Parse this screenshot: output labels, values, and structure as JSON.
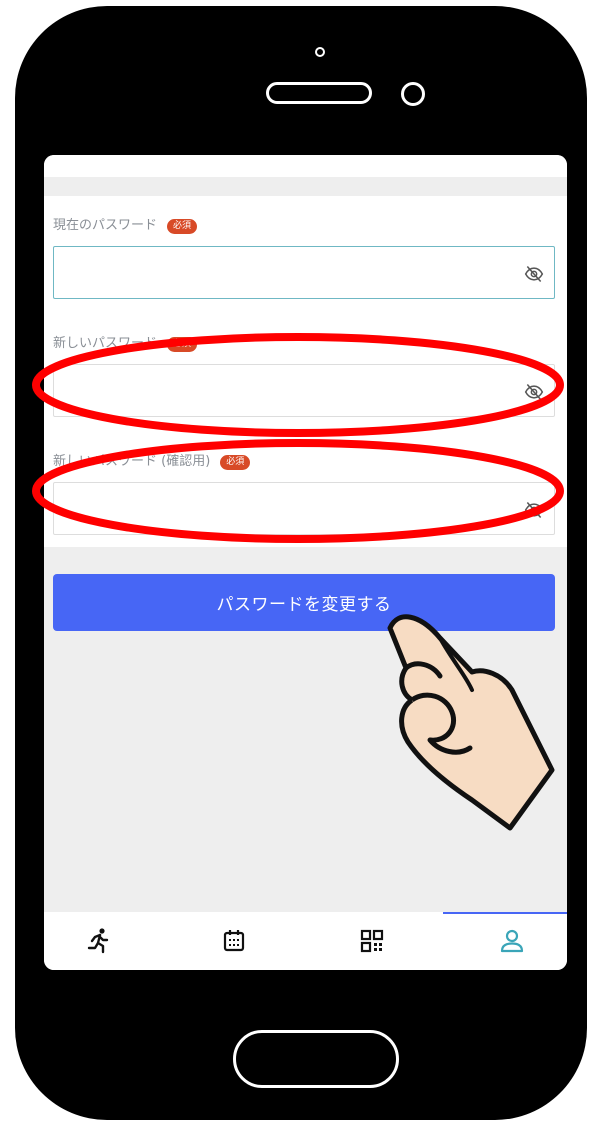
{
  "form": {
    "current_password": {
      "label": "現在のパスワード",
      "badge": "必須"
    },
    "new_password": {
      "label": "新しいパスワード",
      "badge": "必須"
    },
    "confirm_password": {
      "label": "新しいパスワード (確認用)",
      "badge": "必須"
    },
    "submit_label": "パスワードを変更する"
  },
  "tabbar": {
    "tabs": [
      {
        "icon": "running-icon"
      },
      {
        "icon": "calendar-icon"
      },
      {
        "icon": "qr-code-icon"
      },
      {
        "icon": "user-icon",
        "active": true
      }
    ]
  },
  "colors": {
    "accent": "#4766f5",
    "required_badge": "#d84a27",
    "annotation_red": "#ff0000",
    "focus_border": "#6fb8c4"
  }
}
